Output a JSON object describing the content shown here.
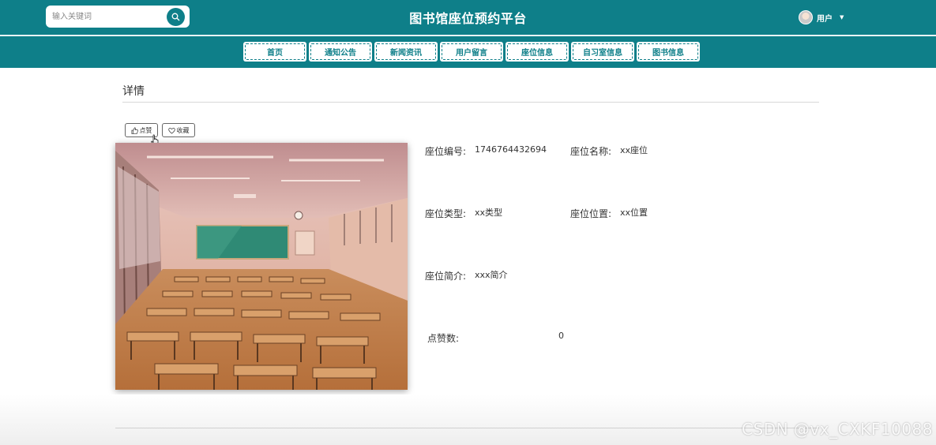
{
  "header": {
    "title": "图书馆座位预约平台",
    "search_placeholder": "输入关键词",
    "user_label": "用户"
  },
  "nav": {
    "items": [
      {
        "label": "首页"
      },
      {
        "label": "通知公告"
      },
      {
        "label": "新闻资讯"
      },
      {
        "label": "用户留言"
      },
      {
        "label": "座位信息"
      },
      {
        "label": "自习室信息"
      },
      {
        "label": "图书信息"
      }
    ]
  },
  "section": {
    "title": "详情"
  },
  "actions": {
    "like_label": "点赞",
    "favorite_label": "收藏"
  },
  "details": {
    "seat_no_label": "座位编号:",
    "seat_no_value": "1746764432694",
    "seat_name_label": "座位名称:",
    "seat_name_value": "xx座位",
    "seat_type_label": "座位类型:",
    "seat_type_value": "xx类型",
    "seat_location_label": "座位位置:",
    "seat_location_value": "xx位置",
    "seat_intro_label": "座位简介:",
    "seat_intro_value": "xxx简介",
    "likes_label": "点赞数:",
    "likes_value": "0"
  },
  "watermark": "CSDN @vx_CXKF10088",
  "colors": {
    "brand": "#0e7f89"
  }
}
